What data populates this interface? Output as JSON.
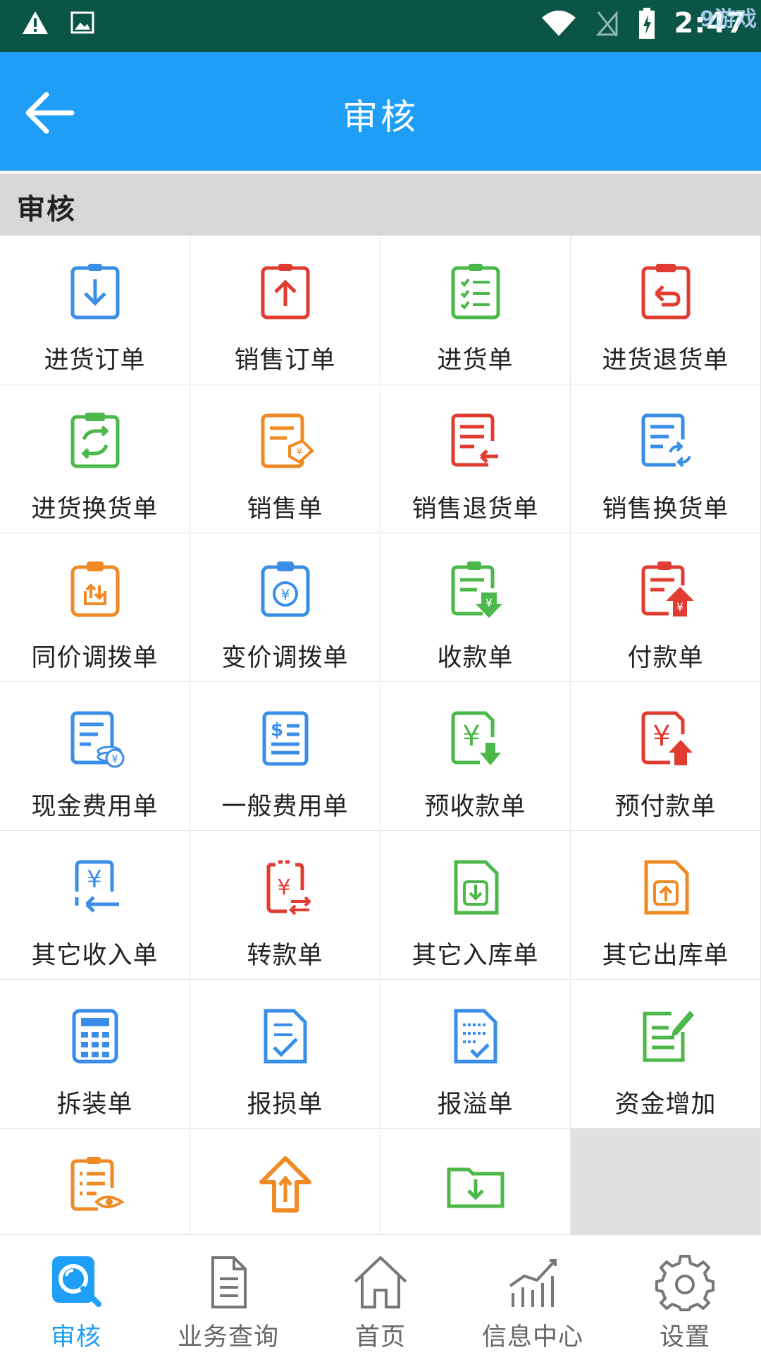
{
  "status_bar": {
    "time": "2:47",
    "watermark": "9游戏"
  },
  "header": {
    "title": "审核"
  },
  "section": {
    "title": "审核"
  },
  "colors": {
    "app_bar": "#1e9ef7",
    "status_bar": "#0a5546",
    "blue": "#3b8ee8",
    "red": "#e03c31",
    "green": "#4cb84a",
    "orange": "#f08a24",
    "active_nav": "#1e9ef7"
  },
  "grid": [
    {
      "label": "进货订单",
      "icon": "inbound-order-icon",
      "color": "blue"
    },
    {
      "label": "销售订单",
      "icon": "sales-order-icon",
      "color": "red"
    },
    {
      "label": "进货单",
      "icon": "purchase-list-icon",
      "color": "green"
    },
    {
      "label": "进货退货单",
      "icon": "purchase-return-icon",
      "color": "red"
    },
    {
      "label": "进货换货单",
      "icon": "purchase-exchange-icon",
      "color": "green"
    },
    {
      "label": "销售单",
      "icon": "sales-doc-icon",
      "color": "orange"
    },
    {
      "label": "销售退货单",
      "icon": "sales-return-icon",
      "color": "red"
    },
    {
      "label": "销售换货单",
      "icon": "sales-exchange-icon",
      "color": "blue"
    },
    {
      "label": "同价调拨单",
      "icon": "same-price-transfer-icon",
      "color": "orange"
    },
    {
      "label": "变价调拨单",
      "icon": "variable-price-transfer-icon",
      "color": "blue"
    },
    {
      "label": "收款单",
      "icon": "receipt-icon",
      "color": "green"
    },
    {
      "label": "付款单",
      "icon": "payment-icon",
      "color": "red"
    },
    {
      "label": "现金费用单",
      "icon": "cash-expense-icon",
      "color": "blue"
    },
    {
      "label": "一般费用单",
      "icon": "general-expense-icon",
      "color": "blue"
    },
    {
      "label": "预收款单",
      "icon": "advance-receipt-icon",
      "color": "green"
    },
    {
      "label": "预付款单",
      "icon": "advance-payment-icon",
      "color": "red"
    },
    {
      "label": "其它收入单",
      "icon": "other-income-icon",
      "color": "blue"
    },
    {
      "label": "转款单",
      "icon": "transfer-funds-icon",
      "color": "red"
    },
    {
      "label": "其它入库单",
      "icon": "other-stock-in-icon",
      "color": "green"
    },
    {
      "label": "其它出库单",
      "icon": "other-stock-out-icon",
      "color": "orange"
    },
    {
      "label": "拆装单",
      "icon": "assembly-icon",
      "color": "blue"
    },
    {
      "label": "报损单",
      "icon": "loss-report-icon",
      "color": "blue"
    },
    {
      "label": "报溢单",
      "icon": "overflow-report-icon",
      "color": "blue"
    },
    {
      "label": "资金增加",
      "icon": "fund-increase-icon",
      "color": "green"
    },
    {
      "label": "",
      "icon": "document-view-icon",
      "color": "orange"
    },
    {
      "label": "",
      "icon": "upload-icon",
      "color": "orange"
    },
    {
      "label": "",
      "icon": "download-folder-icon",
      "color": "green"
    }
  ],
  "bottom_nav": [
    {
      "label": "审核",
      "icon": "audit-search-icon",
      "active": true
    },
    {
      "label": "业务查询",
      "icon": "document-icon",
      "active": false
    },
    {
      "label": "首页",
      "icon": "home-icon",
      "active": false
    },
    {
      "label": "信息中心",
      "icon": "chart-icon",
      "active": false
    },
    {
      "label": "设置",
      "icon": "gear-icon",
      "active": false
    }
  ]
}
